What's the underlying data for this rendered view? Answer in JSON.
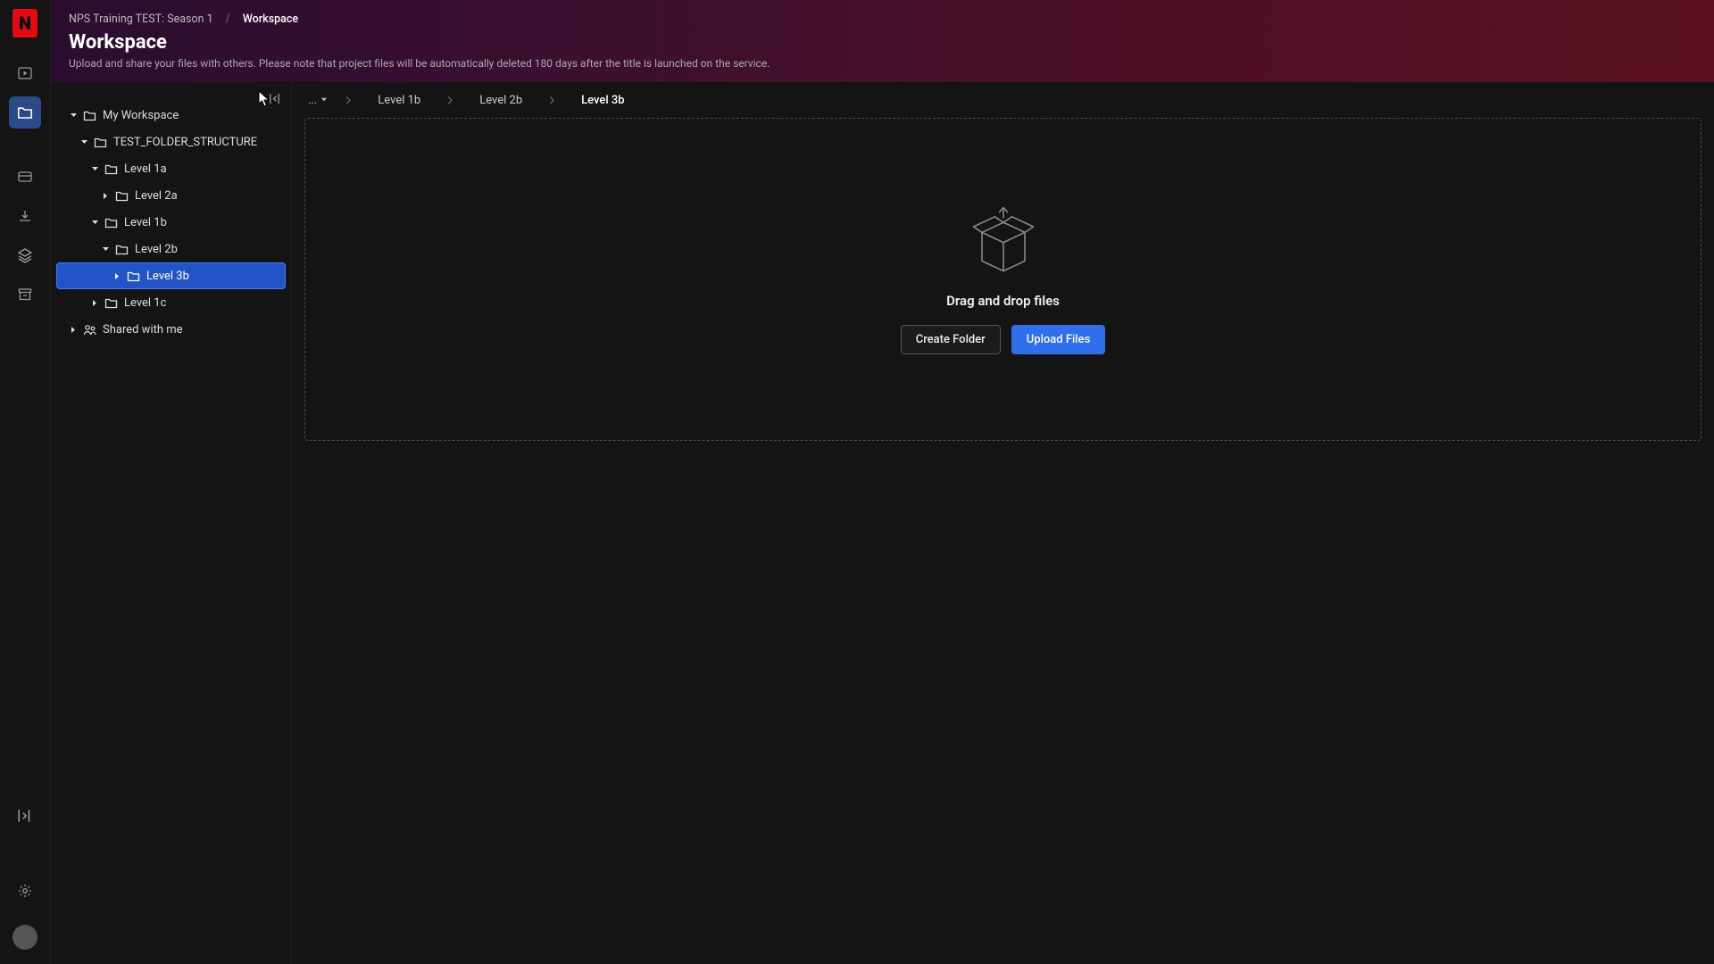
{
  "header": {
    "breadcrumb_root": "NPS Training TEST: Season 1",
    "breadcrumb_current": "Workspace",
    "title": "Workspace",
    "subtitle": "Upload and share your files with others. Please note that project files will be automatically deleted 180 days after the title is launched on the service."
  },
  "tree": {
    "root": "My Workspace",
    "folder_struct": "TEST_FOLDER_STRUCTURE",
    "l1a": "Level 1a",
    "l2a": "Level 2a",
    "l1b": "Level 1b",
    "l2b": "Level 2b",
    "l3b": "Level 3b",
    "l1c": "Level 1c",
    "shared": "Shared with me"
  },
  "breadcrumb": {
    "overflow": "...",
    "items": [
      "Level 1b",
      "Level 2b",
      "Level 3b"
    ]
  },
  "dropzone": {
    "title": "Drag and drop files",
    "create_folder": "Create Folder",
    "upload_files": "Upload Files"
  }
}
